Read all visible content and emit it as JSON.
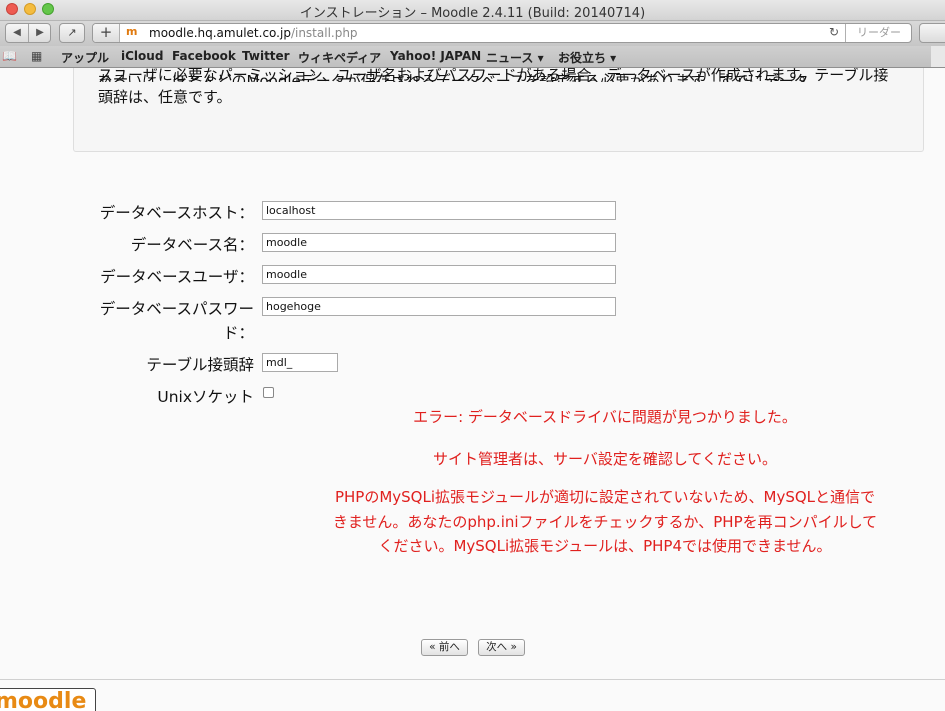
{
  "window": {
    "title": "インストレーション – Moodle 2.4.11 (Build: 20140714)"
  },
  "toolbar": {
    "back": "◀",
    "forward": "▶",
    "share": "↗",
    "add_tab": "+",
    "favicon": "m",
    "url_host": "moodle.hq.amulet.co.jp",
    "url_path": "/install.php",
    "reload": "↻",
    "reader": "リーダー"
  },
  "bookmarks": {
    "items": [
      "アップル",
      "iCloud",
      "Facebook",
      "Twitter",
      "ウィキペディア",
      "Yahoo! JAPAN",
      "ニュース ▾",
      "お役立ち ▾"
    ]
  },
  "info": {
    "cut_line": "あるいは、ほとんどのMoodleデータが保存されるデータベースを設定する必要があります。すでにデータ",
    "text": "スユーザに必要なパーミッション、ユーザ名およびパスワードがある場合、データベースが作成されます。テーブル接頭辞は、任意です。"
  },
  "form": {
    "db_host_label": "データベースホスト：",
    "db_host_value": "localhost",
    "db_name_label": "データベース名：",
    "db_name_value": "moodle",
    "db_user_label": "データベースユーザ：",
    "db_user_value": "moodle",
    "db_pass_label_1": "データベースパスワー",
    "db_pass_label_2": "ド：",
    "db_pass_value": "hogehoge",
    "prefix_label": "テーブル接頭辞",
    "prefix_value": "mdl_",
    "socket_label": "Unixソケット"
  },
  "errors": {
    "line1": "エラー: データベースドライバに問題が見つかりました。",
    "line2": "サイト管理者は、サーバ設定を確認してください。",
    "line3": "PHPのMySQLi拡張モジュールが適切に設定されていないため、MySQLと通信できません。あなたのphp.iniファイルをチェックするか、PHPを再コンパイルしてください。MySQLi拡張モジュールは、PHP4では使用できません。"
  },
  "buttons": {
    "prev": "« 前へ",
    "next": "次へ »"
  },
  "footer": {
    "logo": "moodle"
  },
  "colors": {
    "error": "#e0201e",
    "accent": "#e88a14"
  }
}
